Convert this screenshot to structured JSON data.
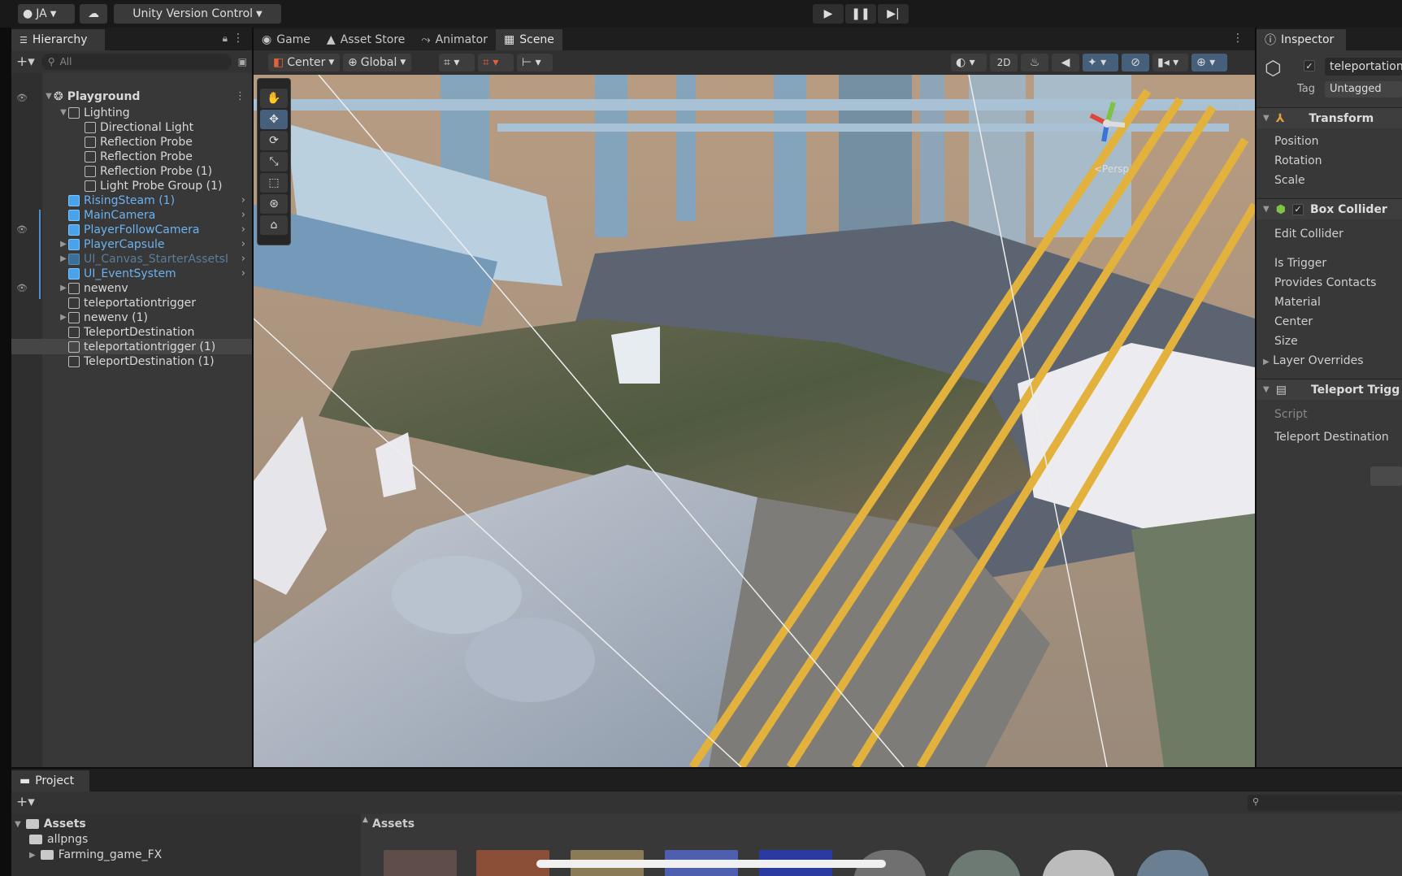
{
  "toolbar": {
    "account_label": "JA",
    "version_control_label": "Unity Version Control"
  },
  "hierarchy": {
    "tab_label": "Hierarchy",
    "search_placeholder": "All",
    "root": "Playground",
    "items": [
      {
        "label": "Lighting",
        "style": "normal"
      },
      {
        "label": "Directional Light",
        "style": "normal"
      },
      {
        "label": "Reflection Probe",
        "style": "normal"
      },
      {
        "label": "Reflection Probe",
        "style": "normal"
      },
      {
        "label": "Reflection Probe (1)",
        "style": "normal"
      },
      {
        "label": "Light Probe Group (1)",
        "style": "normal"
      },
      {
        "label": "RisingSteam (1)",
        "style": "blue"
      },
      {
        "label": "MainCamera",
        "style": "blue"
      },
      {
        "label": "PlayerFollowCamera",
        "style": "blue"
      },
      {
        "label": "PlayerCapsule",
        "style": "blue"
      },
      {
        "label": "UI_Canvas_StarterAssetsI",
        "style": "dim"
      },
      {
        "label": "UI_EventSystem",
        "style": "blue"
      },
      {
        "label": "newenv",
        "style": "normal"
      },
      {
        "label": "teleportationtrigger",
        "style": "normal"
      },
      {
        "label": "newenv (1)",
        "style": "normal"
      },
      {
        "label": "TeleportDestination",
        "style": "normal"
      },
      {
        "label": "teleportationtrigger (1)",
        "style": "selected"
      },
      {
        "label": "TeleportDestination (1)",
        "style": "normal"
      }
    ]
  },
  "scene": {
    "tabs": [
      {
        "label": "Game"
      },
      {
        "label": "Asset Store"
      },
      {
        "label": "Animator"
      },
      {
        "label": "Scene"
      }
    ],
    "pivot_label": "Center",
    "space_label": "Global",
    "mode_2d_label": "2D",
    "gizmo_label": "<Persp"
  },
  "inspector": {
    "tab_label": "Inspector",
    "object_name": "teleportation",
    "tag_label": "Tag",
    "tag_value": "Untagged",
    "transform": {
      "title": "Transform",
      "fields": [
        "Position",
        "Rotation",
        "Scale"
      ]
    },
    "box_collider": {
      "title": "Box Collider",
      "fields": [
        "Edit Collider",
        "Is Trigger",
        "Provides Contacts",
        "Material",
        "Center",
        "Size",
        "Layer Overrides"
      ]
    },
    "teleport": {
      "title": "Teleport Trigg",
      "fields": [
        "Script",
        "Teleport Destination"
      ]
    }
  },
  "project": {
    "tab_label": "Project",
    "tree": [
      {
        "label": "Assets"
      },
      {
        "label": "allpngs"
      },
      {
        "label": "Farming_game_FX"
      }
    ],
    "assets_header": "Assets"
  }
}
